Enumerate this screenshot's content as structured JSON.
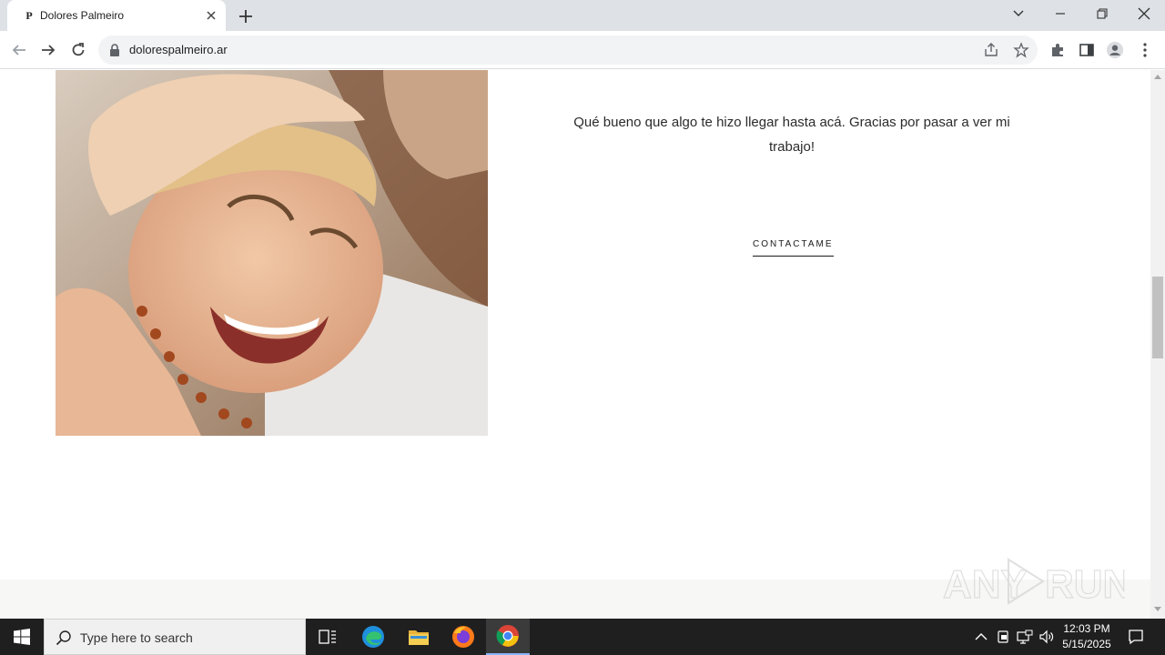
{
  "browser": {
    "tab_title": "Dolores Palmeiro",
    "tab_favicon_letter": "P",
    "url": "dolorespalmeiro.ar"
  },
  "page": {
    "intro_text": "Qué bueno que algo te hizo llegar hasta acá. Gracias por pasar a ver mi trabajo!",
    "contact_label": "CONTACTAME",
    "hero_image_icon": "portrait-photo"
  },
  "watermark": {
    "text_left": "ANY",
    "text_right": "RUN"
  },
  "taskbar": {
    "search_placeholder": "Type here to search",
    "time": "12:03 PM",
    "date": "5/15/2025",
    "apps": [
      "task-view-icon",
      "edge-icon",
      "file-explorer-icon",
      "firefox-icon",
      "chrome-icon"
    ]
  },
  "colors": {
    "titlebar": "#dee1e6",
    "taskbar": "#1f1f1f",
    "text": "#2b2b2b",
    "section_bg": "#f7f7f5"
  }
}
